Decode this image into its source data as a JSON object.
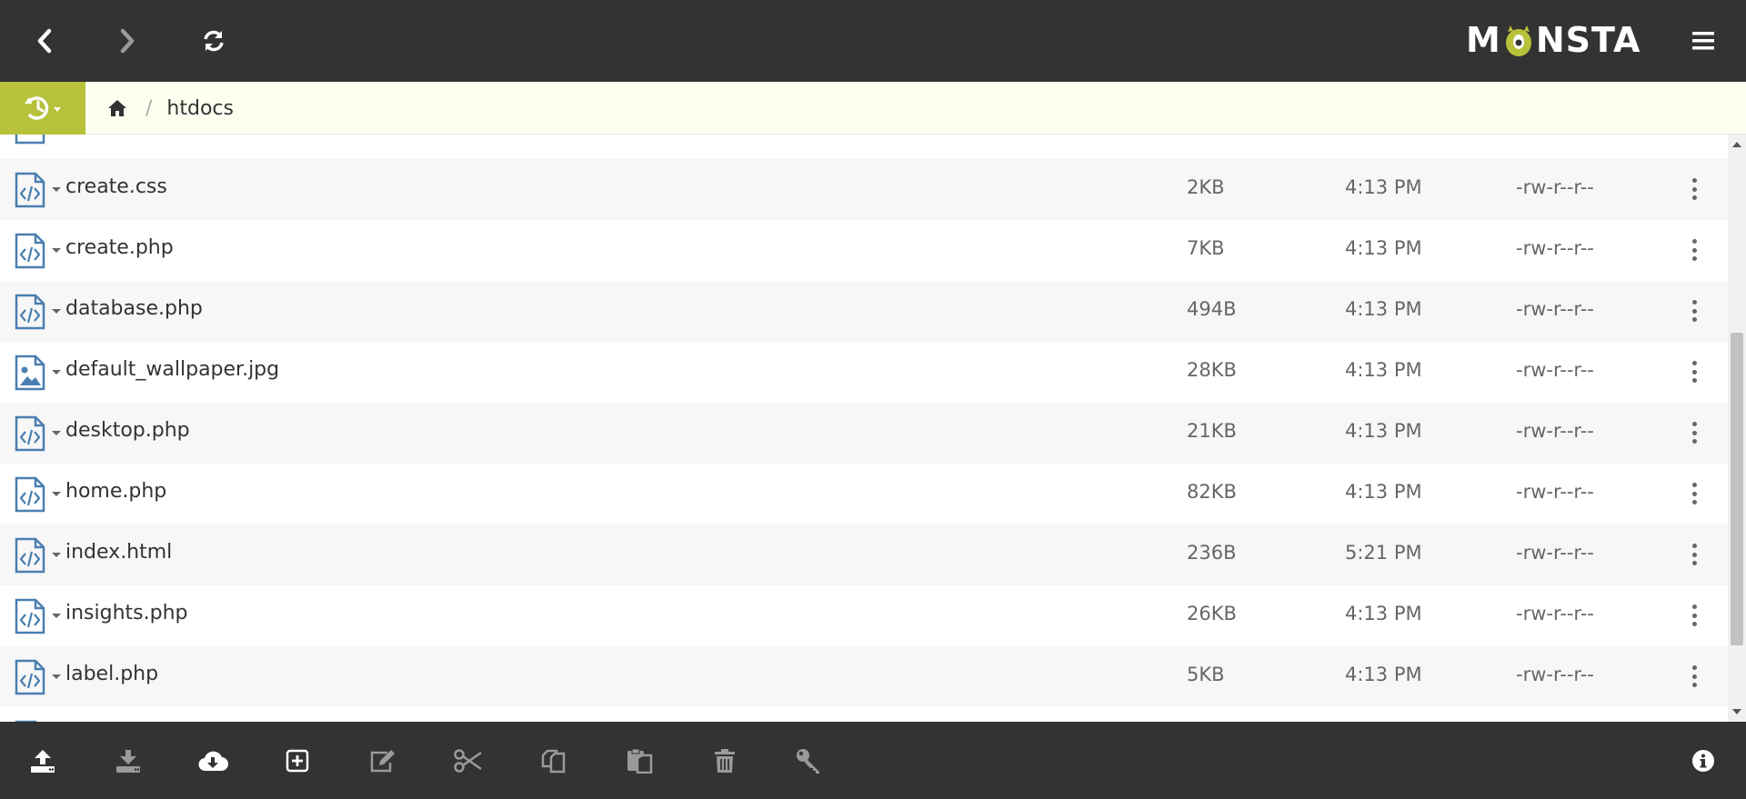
{
  "app": {
    "logo_text_left": "M",
    "logo_text_right": "NSTA"
  },
  "colors": {
    "header_bg": "#333333",
    "accent": "#b8c13a",
    "crumb_bg": "#fffff0",
    "icon_blue": "#4a7fb0",
    "row_alt": "#f7f7f7"
  },
  "topbar": {
    "icons": [
      "back-icon",
      "forward-icon",
      "refresh-icon",
      "menu-icon"
    ]
  },
  "breadcrumb": {
    "home_icon": "home-icon",
    "separator": "/",
    "current": "htdocs"
  },
  "files": [
    {
      "name": "create.css",
      "size": "2KB",
      "modified": "4:13 PM",
      "permissions": "-rw-r--r--",
      "type": "code"
    },
    {
      "name": "create.php",
      "size": "7KB",
      "modified": "4:13 PM",
      "permissions": "-rw-r--r--",
      "type": "code"
    },
    {
      "name": "database.php",
      "size": "494B",
      "modified": "4:13 PM",
      "permissions": "-rw-r--r--",
      "type": "code"
    },
    {
      "name": "default_wallpaper.jpg",
      "size": "28KB",
      "modified": "4:13 PM",
      "permissions": "-rw-r--r--",
      "type": "image"
    },
    {
      "name": "desktop.php",
      "size": "21KB",
      "modified": "4:13 PM",
      "permissions": "-rw-r--r--",
      "type": "code"
    },
    {
      "name": "home.php",
      "size": "82KB",
      "modified": "4:13 PM",
      "permissions": "-rw-r--r--",
      "type": "code"
    },
    {
      "name": "index.html",
      "size": "236B",
      "modified": "5:21 PM",
      "permissions": "-rw-r--r--",
      "type": "code"
    },
    {
      "name": "insights.php",
      "size": "26KB",
      "modified": "4:13 PM",
      "permissions": "-rw-r--r--",
      "type": "code"
    },
    {
      "name": "label.php",
      "size": "5KB",
      "modified": "4:13 PM",
      "permissions": "-rw-r--r--",
      "type": "code"
    }
  ],
  "toolbar": {
    "icons": [
      "upload-icon",
      "download-icon",
      "cloud-download-icon",
      "new-item-icon",
      "edit-icon",
      "cut-icon",
      "copy-icon",
      "paste-icon",
      "delete-icon",
      "key-icon",
      "info-icon"
    ]
  }
}
